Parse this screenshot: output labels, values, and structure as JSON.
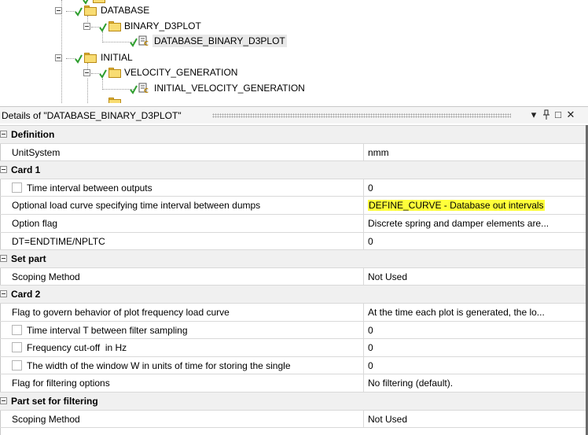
{
  "tree": {
    "nodes": [
      {
        "label": "DATABASE",
        "type": "folder"
      },
      {
        "label": "BINARY_D3PLOT",
        "type": "folder"
      },
      {
        "label": "DATABASE_BINARY_D3PLOT",
        "type": "object",
        "selected": true
      },
      {
        "label": "INITIAL",
        "type": "folder"
      },
      {
        "label": "VELOCITY_GENERATION",
        "type": "folder"
      },
      {
        "label": "INITIAL_VELOCITY_GENERATION",
        "type": "object"
      }
    ]
  },
  "details": {
    "title": "Details of \"DATABASE_BINARY_D3PLOT\"",
    "buttons": {
      "dropdown": "▾",
      "pin": "ᵽ",
      "maximize": "□",
      "close": "✕"
    },
    "groups": {
      "definition": "Definition",
      "card1": "Card 1",
      "set_part": "Set part",
      "card2": "Card 2",
      "part_set_filtering": "Part set for filtering"
    },
    "rows": {
      "unit_system": {
        "label": "UnitSystem",
        "value": "nmm"
      },
      "time_interval_outputs": {
        "label": "Time interval between outputs",
        "value": "0"
      },
      "optional_load_curve": {
        "label": "Optional load curve specifying time interval between dumps",
        "value": "DEFINE_CURVE - Database out intervals"
      },
      "option_flag": {
        "label": "Option flag",
        "value": "Discrete spring and damper elements are..."
      },
      "dt_endtime": {
        "label": "DT=ENDTIME/NPLTC",
        "value": "0"
      },
      "scoping_method_1": {
        "label": "Scoping Method",
        "value": "Not Used"
      },
      "flag_plot_frequency": {
        "label": "Flag to govern behavior of plot frequency load curve",
        "value": "At the time each plot is generated, the lo..."
      },
      "time_interval_filter": {
        "label": "Time interval T between filter sampling",
        "value": "0"
      },
      "frequency_cutoff": {
        "label": "Frequency cut-off  in Hz",
        "value": "0"
      },
      "window_width": {
        "label": "The width of the window W in units of time for storing the single",
        "value": "0"
      },
      "flag_filtering": {
        "label": "Flag for filtering options",
        "value": "No filtering (default)."
      },
      "scoping_method_2": {
        "label": "Scoping Method",
        "value": "Not Used"
      }
    }
  },
  "colors": {
    "highlight": "#ffff3a",
    "check_green": "#2e9e2e",
    "folder_yellow": "#f8dc72",
    "group_bg": "#f0f0f0"
  },
  "icons": {
    "check": "check-icon",
    "folder": "folder-icon",
    "object": "object-icon"
  }
}
